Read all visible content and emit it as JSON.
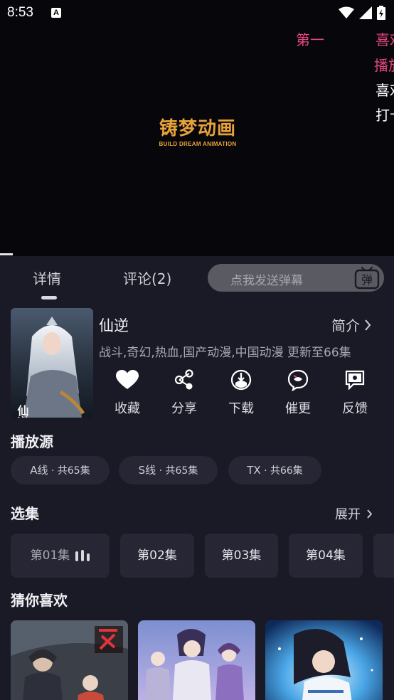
{
  "status_bar": {
    "time": "8:53",
    "notification_icon": "A"
  },
  "video": {
    "logo_cn": "铸梦动画",
    "logo_en": "BUILD DREAM ANIMATION",
    "danmaku": [
      {
        "text": "第一",
        "color": "#e5457f"
      },
      {
        "text": "喜欢",
        "color": "#e5457f"
      },
      {
        "text": "播放",
        "color": "#e5457f"
      },
      {
        "text": "喜欢",
        "color": "#ffffff"
      },
      {
        "text": "打卡",
        "color": "#ffffff"
      }
    ]
  },
  "tabs": {
    "detail": "详情",
    "comments": "评论(2)"
  },
  "danmu_input": {
    "placeholder": "点我发送弹幕",
    "button": "弹"
  },
  "show": {
    "title": "仙逆",
    "intro_label": "简介",
    "tags": "战斗,奇幻,热血,国产动漫,中国动漫 更新至66集",
    "poster_text": "仙逆"
  },
  "actions": [
    {
      "label": "收藏",
      "icon": "heart-icon"
    },
    {
      "label": "分享",
      "icon": "share-icon"
    },
    {
      "label": "下载",
      "icon": "download-icon"
    },
    {
      "label": "催更",
      "icon": "urge-icon"
    },
    {
      "label": "反馈",
      "icon": "feedback-icon"
    }
  ],
  "sources": {
    "heading": "播放源",
    "items": [
      {
        "name": "A线",
        "count": " · 共65集"
      },
      {
        "name": "S线",
        "count": " · 共65集"
      },
      {
        "name": "TX",
        "count": " · 共66集"
      }
    ]
  },
  "episodes": {
    "heading": "选集",
    "expand": "展开",
    "items": [
      "第01集",
      "第02集",
      "第03集",
      "第04集"
    ]
  },
  "recommend": {
    "heading": "猜你喜欢"
  },
  "colors": {
    "accent": "#e5457f",
    "background": "#1a1a26",
    "chip": "#262634"
  }
}
